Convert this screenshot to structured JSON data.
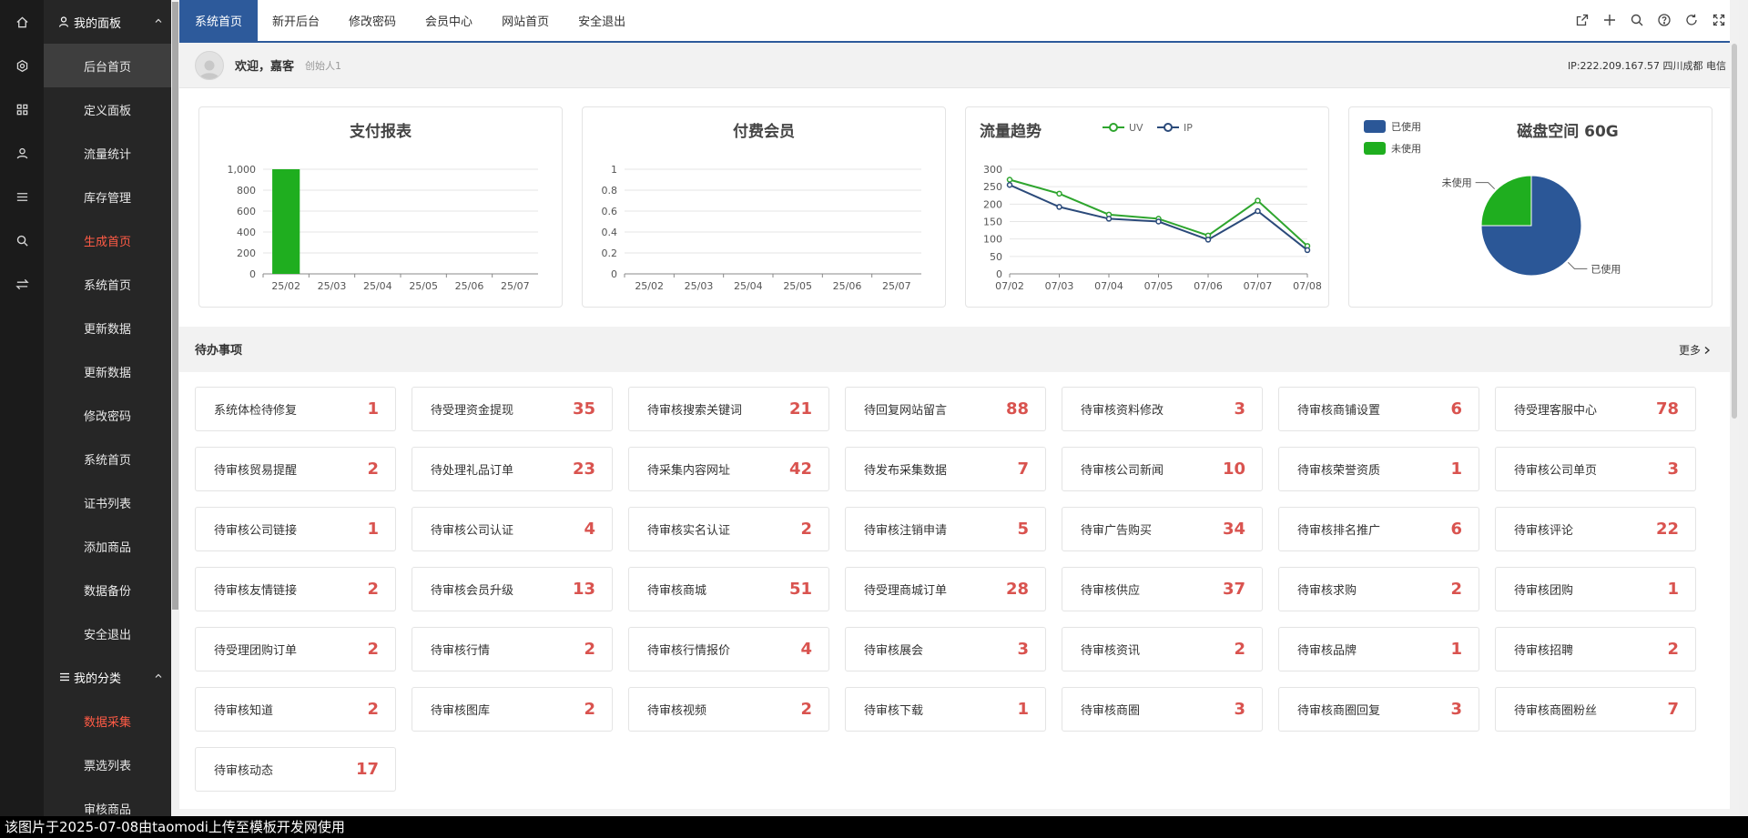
{
  "sidebar": {
    "group1": "我的面板",
    "items1": [
      {
        "label": "后台首页",
        "state": "active"
      },
      {
        "label": "定义面板",
        "state": ""
      },
      {
        "label": "流量统计",
        "state": ""
      },
      {
        "label": "库存管理",
        "state": ""
      },
      {
        "label": "生成首页",
        "state": "hl"
      },
      {
        "label": "系统首页",
        "state": ""
      },
      {
        "label": "更新数据",
        "state": ""
      },
      {
        "label": "更新数据",
        "state": ""
      },
      {
        "label": "修改密码",
        "state": ""
      },
      {
        "label": "系统首页",
        "state": ""
      },
      {
        "label": "证书列表",
        "state": ""
      },
      {
        "label": "添加商品",
        "state": ""
      },
      {
        "label": "数据备份",
        "state": ""
      },
      {
        "label": "安全退出",
        "state": ""
      }
    ],
    "group2": "我的分类",
    "items2": [
      {
        "label": "数据采集",
        "state": "hl"
      },
      {
        "label": "票选列表",
        "state": ""
      },
      {
        "label": "审核商品",
        "state": ""
      }
    ]
  },
  "topbar": {
    "tabs": [
      "系统首页",
      "新开后台",
      "修改密码",
      "会员中心",
      "网站首页",
      "安全退出"
    ]
  },
  "welcome": {
    "greeting": "欢迎，嘉客",
    "role": "创始人1",
    "ip": "IP:222.209.167.57 四川成都 电信"
  },
  "todo": {
    "title": "待办事项",
    "more": "更多",
    "items": [
      {
        "label": "系统体检待修复",
        "count": "1"
      },
      {
        "label": "待受理资金提现",
        "count": "35"
      },
      {
        "label": "待审核搜索关键词",
        "count": "21"
      },
      {
        "label": "待回复网站留言",
        "count": "88"
      },
      {
        "label": "待审核资料修改",
        "count": "3"
      },
      {
        "label": "待审核商铺设置",
        "count": "6"
      },
      {
        "label": "待受理客服中心",
        "count": "78"
      },
      {
        "label": "待审核贸易提醒",
        "count": "2"
      },
      {
        "label": "待处理礼品订单",
        "count": "23"
      },
      {
        "label": "待采集内容网址",
        "count": "42"
      },
      {
        "label": "待发布采集数据",
        "count": "7"
      },
      {
        "label": "待审核公司新闻",
        "count": "10"
      },
      {
        "label": "待审核荣誉资质",
        "count": "1"
      },
      {
        "label": "待审核公司单页",
        "count": "3"
      },
      {
        "label": "待审核公司链接",
        "count": "1"
      },
      {
        "label": "待审核公司认证",
        "count": "4"
      },
      {
        "label": "待审核实名认证",
        "count": "2"
      },
      {
        "label": "待审核注销申请",
        "count": "5"
      },
      {
        "label": "待审广告购买",
        "count": "34"
      },
      {
        "label": "待审核排名推广",
        "count": "6"
      },
      {
        "label": "待审核评论",
        "count": "22"
      },
      {
        "label": "待审核友情链接",
        "count": "2"
      },
      {
        "label": "待审核会员升级",
        "count": "13"
      },
      {
        "label": "待审核商城",
        "count": "51"
      },
      {
        "label": "待受理商城订单",
        "count": "28"
      },
      {
        "label": "待审核供应",
        "count": "37"
      },
      {
        "label": "待审核求购",
        "count": "2"
      },
      {
        "label": "待审核团购",
        "count": "1"
      },
      {
        "label": "待受理团购订单",
        "count": "2"
      },
      {
        "label": "待审核行情",
        "count": "2"
      },
      {
        "label": "待审核行情报价",
        "count": "4"
      },
      {
        "label": "待审核展会",
        "count": "3"
      },
      {
        "label": "待审核资讯",
        "count": "2"
      },
      {
        "label": "待审核品牌",
        "count": "1"
      },
      {
        "label": "待审核招聘",
        "count": "2"
      },
      {
        "label": "待审核知道",
        "count": "2"
      },
      {
        "label": "待审核图库",
        "count": "2"
      },
      {
        "label": "待审核视频",
        "count": "2"
      },
      {
        "label": "待审核下载",
        "count": "1"
      },
      {
        "label": "待审核商圈",
        "count": "3"
      },
      {
        "label": "待审核商圈回复",
        "count": "3"
      },
      {
        "label": "待审核商圈粉丝",
        "count": "7"
      },
      {
        "label": "待审核动态",
        "count": "17"
      }
    ]
  },
  "caption": "该图片于2025-07-08由taomodi上传至模板开发网使用",
  "colors": {
    "accent": "#2d5a9b",
    "bar_green": "#1fae1f",
    "uv_line": "#2ea52e",
    "ip_line": "#2b4a7a",
    "pie_used": "#2b5797",
    "pie_unused": "#1fae1f",
    "count_red": "#d9534f"
  },
  "chart_data": [
    {
      "type": "bar",
      "title": "支付报表",
      "categories": [
        "25/02",
        "25/03",
        "25/04",
        "25/05",
        "25/06",
        "25/07"
      ],
      "values": [
        1000,
        0,
        0,
        0,
        0,
        0
      ],
      "yticks": [
        "0",
        "200",
        "400",
        "600",
        "800",
        "1,000"
      ],
      "ylim": [
        0,
        1000
      ]
    },
    {
      "type": "bar",
      "title": "付费会员",
      "categories": [
        "25/02",
        "25/03",
        "25/04",
        "25/05",
        "25/06",
        "25/07"
      ],
      "values": [
        0,
        0,
        0,
        0,
        0,
        0
      ],
      "yticks": [
        "0",
        "0.2",
        "0.4",
        "0.6",
        "0.8",
        "1"
      ],
      "ylim": [
        0,
        1
      ]
    },
    {
      "type": "line",
      "title": "流量趋势",
      "categories": [
        "07/02",
        "07/03",
        "07/04",
        "07/05",
        "07/06",
        "07/07",
        "07/08"
      ],
      "yticks": [
        "0",
        "50",
        "100",
        "150",
        "200",
        "250",
        "300"
      ],
      "ylim": [
        0,
        300
      ],
      "series": [
        {
          "name": "UV",
          "values": [
            270,
            230,
            170,
            158,
            110,
            210,
            80
          ]
        },
        {
          "name": "IP",
          "values": [
            255,
            192,
            158,
            150,
            98,
            180,
            68
          ]
        }
      ],
      "legend": "top"
    },
    {
      "type": "pie",
      "title": "磁盘空间 60G",
      "slices": [
        {
          "name": "已使用",
          "value": 75
        },
        {
          "name": "未使用",
          "value": 25
        }
      ],
      "legend": "top-left"
    }
  ]
}
